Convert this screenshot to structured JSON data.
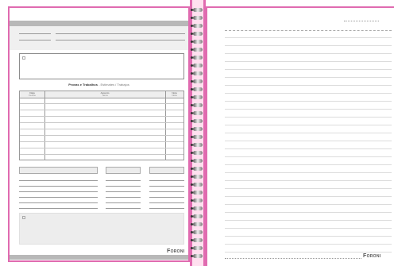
{
  "left_page": {
    "section_title": "Provas e Trabalhos",
    "section_subtitle": "- Estimates / Trabajos",
    "columns": [
      {
        "label": "Data",
        "sub": "Fecha"
      },
      {
        "label": "Assunto",
        "sub": "Tema"
      },
      {
        "label": "Nota",
        "sub": "Nota"
      }
    ],
    "brand": "Foroni"
  },
  "right_page": {
    "brand": "Foroni"
  },
  "colors": {
    "accent": "#e06bb0",
    "grey_bar": "#b8b8b8"
  }
}
